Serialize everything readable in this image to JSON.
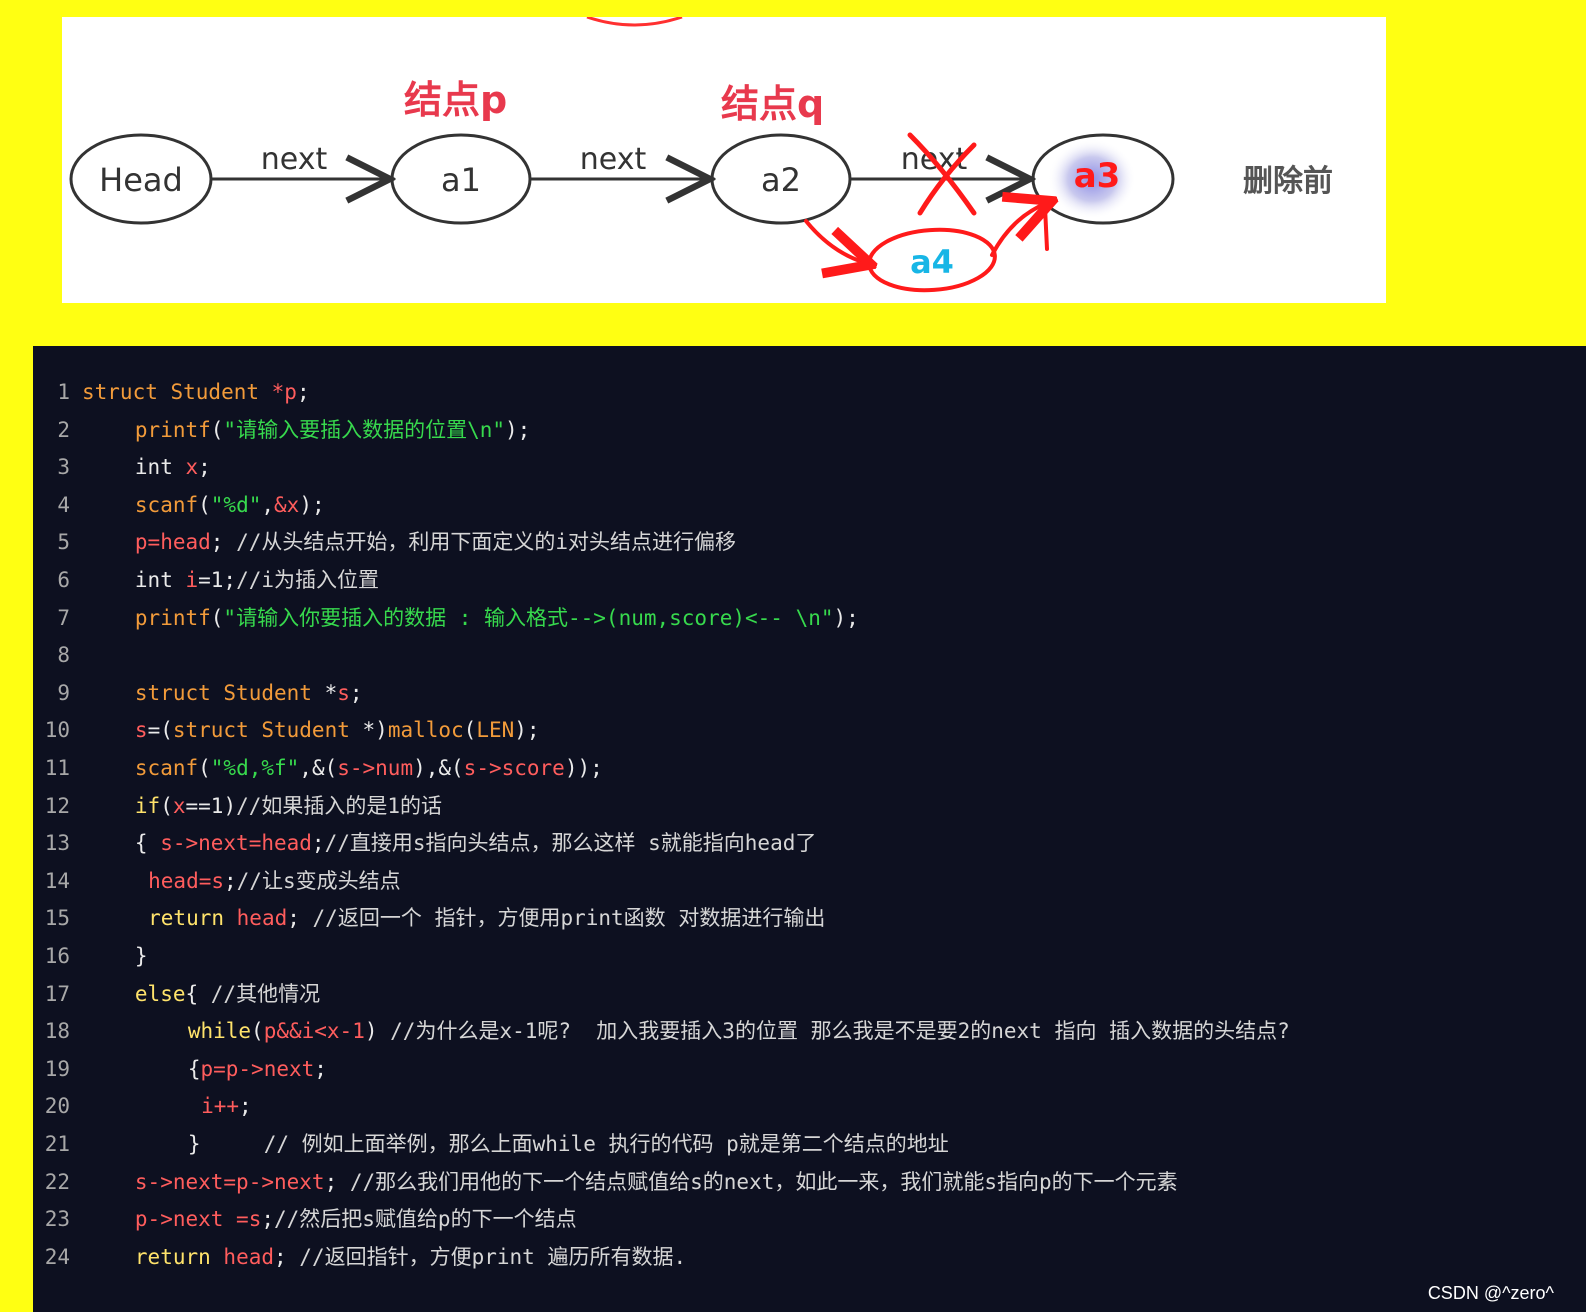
{
  "diagram": {
    "nodes": [
      "Head",
      "a1",
      "a2",
      "a3"
    ],
    "edge_labels": [
      "next",
      "next",
      "next"
    ],
    "tags": [
      "结点p",
      "结点q"
    ],
    "side_label": "删除前",
    "annotation_node": "a4",
    "annotation_colors": {
      "red": "#ff1a1a",
      "cyan": "#17b6e6"
    }
  },
  "code": {
    "lines": [
      {
        "no": "1",
        "indent": 0,
        "tokens": [
          [
            "kw",
            "struct Student "
          ],
          [
            "var",
            "*p"
          ],
          [
            "op",
            ";"
          ]
        ]
      },
      {
        "no": "2",
        "indent": 4,
        "tokens": [
          [
            "fn",
            "printf"
          ],
          [
            "op",
            "("
          ],
          [
            "str",
            "\"请输入要插入数据的位置\\n\""
          ],
          [
            "op",
            ");"
          ]
        ]
      },
      {
        "no": "3",
        "indent": 4,
        "tokens": [
          [
            "op",
            "int "
          ],
          [
            "var",
            "x"
          ],
          [
            "op",
            ";"
          ]
        ]
      },
      {
        "no": "4",
        "indent": 4,
        "tokens": [
          [
            "fn",
            "scanf"
          ],
          [
            "op",
            "("
          ],
          [
            "str",
            "\"%d\""
          ],
          [
            "op",
            ","
          ],
          [
            "var",
            "&x"
          ],
          [
            "op",
            ");"
          ]
        ]
      },
      {
        "no": "5",
        "indent": 4,
        "tokens": [
          [
            "var",
            "p=head"
          ],
          [
            "op",
            "; "
          ],
          [
            "cm",
            "//从头结点开始，利用下面定义的i对头结点进行偏移"
          ]
        ]
      },
      {
        "no": "6",
        "indent": 4,
        "tokens": [
          [
            "op",
            "int "
          ],
          [
            "var",
            "i"
          ],
          [
            "op",
            "=1;"
          ],
          [
            "cm",
            "//i为插入位置"
          ]
        ]
      },
      {
        "no": "7",
        "indent": 4,
        "tokens": [
          [
            "fn",
            "printf"
          ],
          [
            "op",
            "("
          ],
          [
            "str",
            "\"请输入你要插入的数据 : 输入格式-->(num,score)<-- \\n\""
          ],
          [
            "op",
            ");"
          ]
        ]
      },
      {
        "no": "8",
        "indent": 0,
        "tokens": []
      },
      {
        "no": "9",
        "indent": 4,
        "tokens": [
          [
            "kw",
            "struct Student "
          ],
          [
            "op",
            "*"
          ],
          [
            "var",
            "s"
          ],
          [
            "op",
            ";"
          ]
        ]
      },
      {
        "no": "10",
        "indent": 4,
        "tokens": [
          [
            "var",
            "s"
          ],
          [
            "op",
            "=("
          ],
          [
            "kw",
            "struct Student "
          ],
          [
            "op",
            "*)"
          ],
          [
            "fn",
            "malloc"
          ],
          [
            "op",
            "("
          ],
          [
            "kw",
            "LEN"
          ],
          [
            "op",
            ");"
          ]
        ]
      },
      {
        "no": "11",
        "indent": 4,
        "tokens": [
          [
            "fn",
            "scanf"
          ],
          [
            "op",
            "("
          ],
          [
            "str",
            "\"%d,%f\""
          ],
          [
            "op",
            ",&("
          ],
          [
            "var",
            "s->num"
          ],
          [
            "op",
            "),&("
          ],
          [
            "var",
            "s->score"
          ],
          [
            "op",
            "));"
          ]
        ]
      },
      {
        "no": "12",
        "indent": 4,
        "tokens": [
          [
            "bright",
            "if"
          ],
          [
            "op",
            "("
          ],
          [
            "var",
            "x"
          ],
          [
            "op",
            "==1)"
          ],
          [
            "cm",
            "//如果插入的是1的话"
          ]
        ]
      },
      {
        "no": "13",
        "indent": 4,
        "tokens": [
          [
            "op",
            "{ "
          ],
          [
            "var",
            "s->next=head"
          ],
          [
            "op",
            ";"
          ],
          [
            "cm",
            "//直接用s指向头结点，那么这样 s就能指向head了"
          ]
        ]
      },
      {
        "no": "14",
        "indent": 5,
        "tokens": [
          [
            "var",
            "head=s"
          ],
          [
            "op",
            ";"
          ],
          [
            "cm",
            "//让s变成头结点"
          ]
        ]
      },
      {
        "no": "15",
        "indent": 5,
        "tokens": [
          [
            "bright",
            "return "
          ],
          [
            "var",
            "head"
          ],
          [
            "op",
            "; "
          ],
          [
            "cm",
            "//返回一个 指针，方便用print函数 对数据进行输出"
          ]
        ]
      },
      {
        "no": "16",
        "indent": 4,
        "tokens": [
          [
            "op",
            "}"
          ]
        ]
      },
      {
        "no": "17",
        "indent": 4,
        "tokens": [
          [
            "bright",
            "else"
          ],
          [
            "op",
            "{ "
          ],
          [
            "cm",
            "//其他情况"
          ]
        ]
      },
      {
        "no": "18",
        "indent": 8,
        "tokens": [
          [
            "bright",
            "while"
          ],
          [
            "op",
            "("
          ],
          [
            "var",
            "p&&i<x-1"
          ],
          [
            "op",
            ") "
          ],
          [
            "cm",
            "//为什么是x-1呢?  加入我要插入3的位置 那么我是不是要2的next 指向 插入数据的头结点?"
          ]
        ]
      },
      {
        "no": "19",
        "indent": 8,
        "tokens": [
          [
            "op",
            "{"
          ],
          [
            "var",
            "p=p->next"
          ],
          [
            "op",
            ";"
          ]
        ]
      },
      {
        "no": "20",
        "indent": 9,
        "tokens": [
          [
            "var",
            "i++"
          ],
          [
            "op",
            ";"
          ]
        ]
      },
      {
        "no": "21",
        "indent": 8,
        "tokens": [
          [
            "op",
            "}     "
          ],
          [
            "cm",
            "// 例如上面举例，那么上面while 执行的代码 p就是第二个结点的地址"
          ]
        ]
      },
      {
        "no": "22",
        "indent": 4,
        "tokens": [
          [
            "var",
            "s->next=p->next"
          ],
          [
            "op",
            "; "
          ],
          [
            "cm",
            "//那么我们用他的下一个结点赋值给s的next，如此一来，我们就能s指向p的下一个元素"
          ]
        ]
      },
      {
        "no": "23",
        "indent": 4,
        "tokens": [
          [
            "var",
            "p->next =s"
          ],
          [
            "op",
            ";"
          ],
          [
            "cm",
            "//然后把s赋值给p的下一个结点"
          ]
        ]
      },
      {
        "no": "24",
        "indent": 4,
        "tokens": [
          [
            "bright",
            "return "
          ],
          [
            "var",
            "head"
          ],
          [
            "op",
            "; "
          ],
          [
            "cm",
            "//返回指针，方便print 遍历所有数据."
          ]
        ]
      }
    ]
  },
  "watermark": "CSDN @^zero^"
}
